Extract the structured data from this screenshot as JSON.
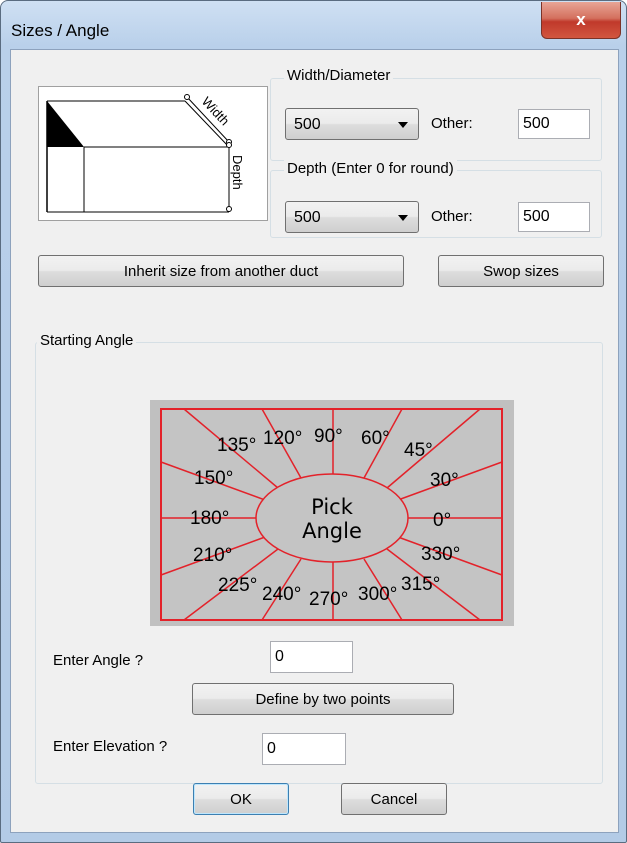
{
  "window": {
    "title": "Sizes / Angle",
    "close_glyph": "x"
  },
  "width_group": {
    "label": "Width/Diameter",
    "selected": "500",
    "other_label": "Other:",
    "other_value": "500"
  },
  "depth_group": {
    "label": "Depth (Enter 0 for round)",
    "selected": "500",
    "other_label": "Other:",
    "other_value": "500"
  },
  "diagram": {
    "width_label": "Width",
    "depth_label": "Depth"
  },
  "buttons": {
    "inherit": "Inherit size from another duct",
    "swap": "Swop sizes",
    "define": "Define by two points",
    "ok": "OK",
    "cancel": "Cancel"
  },
  "angle_group": {
    "label": "Starting Angle"
  },
  "angle_picker": {
    "center_line1": "Pick",
    "center_line2": "Angle",
    "angles": [
      "0°",
      "30°",
      "45°",
      "60°",
      "90°",
      "120°",
      "135°",
      "150°",
      "180°",
      "210°",
      "225°",
      "240°",
      "270°",
      "300°",
      "315°",
      "330°"
    ]
  },
  "angle_input": {
    "label": "Enter Angle ?",
    "value": "0"
  },
  "elevation_input": {
    "label": "Enter Elevation ?",
    "value": "0"
  },
  "colors": {
    "picker_line": "#e3222a",
    "picker_bg": "#c0c0c0",
    "close_button": "#c0392b"
  }
}
